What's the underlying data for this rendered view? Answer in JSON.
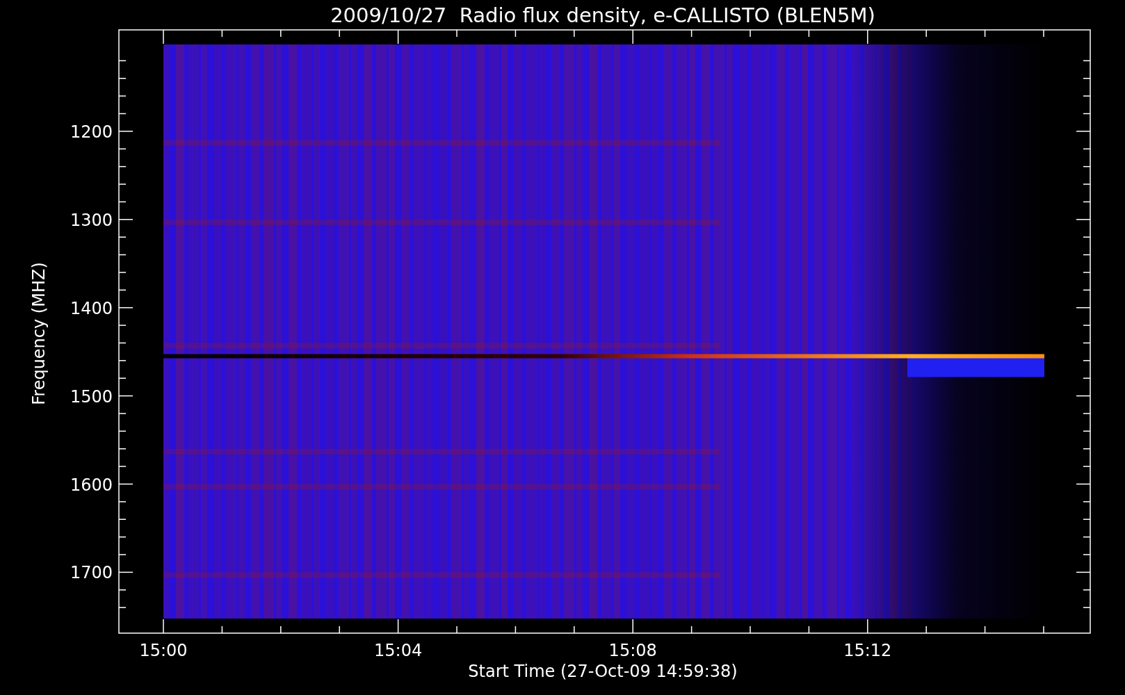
{
  "title": "2009/10/27  Radio flux density, e-CALLISTO (BLEN5M)",
  "y_axis": {
    "label": "Frequency (MHZ)",
    "ticks": [
      "1200",
      "1300",
      "1400",
      "1500",
      "1600",
      "1700"
    ]
  },
  "x_axis": {
    "label": "Start Time (27-Oct-09 14:59:38)",
    "ticks": [
      "15:00",
      "15:04",
      "15:08",
      "15:12"
    ]
  }
}
